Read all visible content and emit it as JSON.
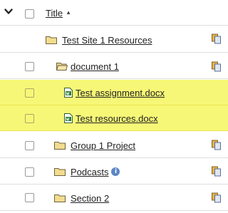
{
  "header": {
    "title_label": "Title",
    "sort_indicator": "▲",
    "toggle_icon": "chevron-down-icon"
  },
  "rows": [
    {
      "label": "Test Site 1 Resources",
      "type": "folder",
      "checkbox": false,
      "highlighted": false
    },
    {
      "label": "document 1",
      "type": "folder-open",
      "checkbox": true,
      "highlighted": false
    },
    {
      "label": "Test assignment.docx",
      "type": "word-document",
      "checkbox": true,
      "highlighted": true
    },
    {
      "label": "Test resources.docx",
      "type": "word-document",
      "checkbox": true,
      "highlighted": true
    },
    {
      "label": "Group 1 Project",
      "type": "folder",
      "checkbox": true,
      "highlighted": false
    },
    {
      "label": "Podcasts",
      "type": "folder",
      "checkbox": true,
      "highlighted": false,
      "info_icon": "i"
    },
    {
      "label": "Section 2",
      "type": "folder",
      "checkbox": true,
      "highlighted": false
    }
  ],
  "colors": {
    "highlight": "#f7f777",
    "folder": "#f2dc8e",
    "info": "#5b86c5"
  }
}
